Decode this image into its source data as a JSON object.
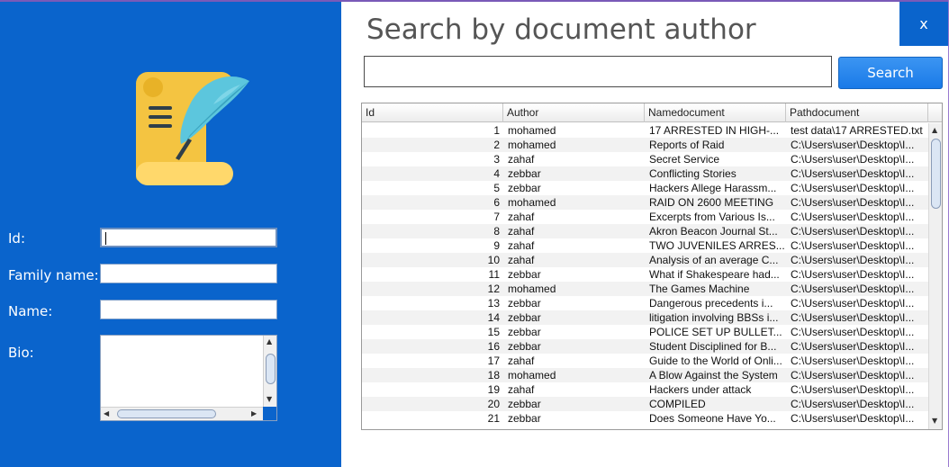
{
  "form": {
    "id_label": "Id:",
    "family_label": "Family name:",
    "name_label": "Name:",
    "bio_label": "Bio:",
    "id_value": "",
    "family_value": "",
    "name_value": "",
    "bio_value": ""
  },
  "close_label": "x",
  "title": "Search by document author",
  "search": {
    "value": "",
    "button_label": "Search"
  },
  "table": {
    "headers": [
      "Id",
      "Author",
      "Namedocument",
      "Pathdocument"
    ],
    "rows": [
      [
        "1",
        "mohamed",
        "17 ARRESTED IN HIGH-...",
        "test data\\17 ARRESTED.txt"
      ],
      [
        "2",
        "mohamed",
        "Reports of Raid",
        "C:\\Users\\user\\Desktop\\I..."
      ],
      [
        "3",
        "zahaf",
        "Secret Service",
        "C:\\Users\\user\\Desktop\\I..."
      ],
      [
        "4",
        "zebbar",
        "Conflicting Stories",
        "C:\\Users\\user\\Desktop\\I..."
      ],
      [
        "5",
        "zebbar",
        "Hackers Allege Harassm...",
        "C:\\Users\\user\\Desktop\\I..."
      ],
      [
        "6",
        "mohamed",
        "RAID ON 2600 MEETING",
        "C:\\Users\\user\\Desktop\\I..."
      ],
      [
        "7",
        "zahaf",
        "Excerpts from Various Is...",
        "C:\\Users\\user\\Desktop\\I..."
      ],
      [
        "8",
        "zahaf",
        "Akron Beacon Journal St...",
        "C:\\Users\\user\\Desktop\\I..."
      ],
      [
        "9",
        "zahaf",
        "TWO JUVENILES ARRES...",
        "C:\\Users\\user\\Desktop\\I..."
      ],
      [
        "10",
        "zahaf",
        "Analysis of an average C...",
        "C:\\Users\\user\\Desktop\\I..."
      ],
      [
        "11",
        "zebbar",
        "What if Shakespeare had...",
        "C:\\Users\\user\\Desktop\\I..."
      ],
      [
        "12",
        "mohamed",
        "The Games Machine",
        "C:\\Users\\user\\Desktop\\I..."
      ],
      [
        "13",
        "zebbar",
        "Dangerous precedents i...",
        "C:\\Users\\user\\Desktop\\I..."
      ],
      [
        "14",
        "zebbar",
        "litigation involving BBSs i...",
        "C:\\Users\\user\\Desktop\\I..."
      ],
      [
        "15",
        "zebbar",
        "POLICE SET UP BULLET...",
        "C:\\Users\\user\\Desktop\\I..."
      ],
      [
        "16",
        "zebbar",
        "Student Disciplined for B...",
        "C:\\Users\\user\\Desktop\\I..."
      ],
      [
        "17",
        "zahaf",
        "Guide to the World of Onli...",
        "C:\\Users\\user\\Desktop\\I..."
      ],
      [
        "18",
        "mohamed",
        "A Blow Against the System",
        "C:\\Users\\user\\Desktop\\I..."
      ],
      [
        "19",
        "zahaf",
        "Hackers under attack",
        "C:\\Users\\user\\Desktop\\I..."
      ],
      [
        "20",
        "zebbar",
        "COMPILED",
        "C:\\Users\\user\\Desktop\\I..."
      ],
      [
        "21",
        "zebbar",
        "Does Someone Have Yo...",
        "C:\\Users\\user\\Desktop\\I..."
      ]
    ]
  }
}
